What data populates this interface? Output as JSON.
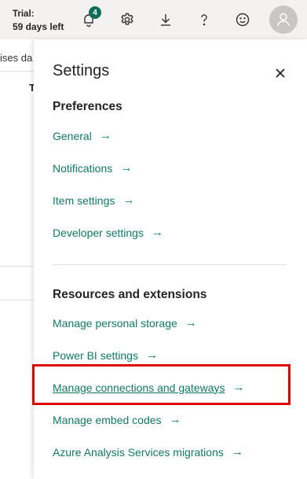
{
  "topbar": {
    "trial_line1": "Trial:",
    "trial_line2": "59 days left",
    "notifications_count": "4",
    "icons": [
      "bell-icon",
      "gear-icon",
      "download-icon",
      "help-icon",
      "smiley-icon",
      "avatar-icon"
    ]
  },
  "background": {
    "fragment_text": "ises da",
    "fragment_letter": "T"
  },
  "settings": {
    "title": "Settings",
    "preferences_heading": "Preferences",
    "preferences": [
      {
        "label": "General"
      },
      {
        "label": "Notifications"
      },
      {
        "label": "Item settings"
      },
      {
        "label": "Developer settings"
      }
    ],
    "resources_heading": "Resources and extensions",
    "resources": [
      {
        "label": "Manage personal storage"
      },
      {
        "label": "Power BI settings"
      },
      {
        "label": "Manage connections and gateways"
      },
      {
        "label": "Manage embed codes"
      },
      {
        "label": "Azure Analysis Services migrations"
      }
    ],
    "arrow": "→",
    "close": "✕"
  },
  "colors": {
    "link": "#117865",
    "badge": "#0e6e5a",
    "highlight": "#e00000"
  }
}
